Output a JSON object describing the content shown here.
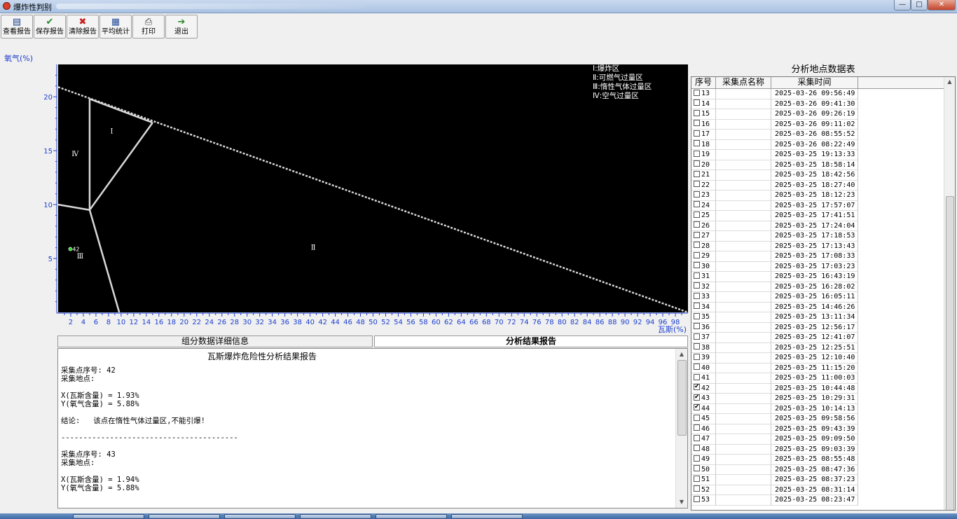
{
  "window": {
    "title": "爆炸性判别",
    "min": "—",
    "max": "□",
    "close": "✕"
  },
  "toolbar": [
    {
      "id": "view",
      "label": "查看报告",
      "icon": "report-icon",
      "glyph": "▤",
      "color": "#1c3f8a"
    },
    {
      "id": "save",
      "label": "保存报告",
      "icon": "check-icon",
      "glyph": "✔",
      "color": "#1e8a2a"
    },
    {
      "id": "clear",
      "label": "清除报告",
      "icon": "x-icon",
      "glyph": "✖",
      "color": "#c81e1e"
    },
    {
      "id": "avg",
      "label": "平均统计",
      "icon": "stats-icon",
      "glyph": "▦",
      "color": "#2a4f9a"
    },
    {
      "id": "print",
      "label": "打印",
      "icon": "printer-icon",
      "glyph": "⎙",
      "color": "#333333"
    },
    {
      "id": "exit",
      "label": "退出",
      "icon": "exit-icon",
      "glyph": "➔",
      "color": "#2e8a24"
    }
  ],
  "chart": {
    "ylabel": "氧气(%)",
    "xlabel": "瓦斯(%)",
    "legend": [
      "Ⅰ:爆炸区",
      "Ⅱ:可燃气过量区",
      "Ⅲ:惰性气体过量区",
      "Ⅳ:空气过量区"
    ],
    "region_labels": [
      {
        "text": "Ⅰ",
        "x": 8.5,
        "y": 16.6
      },
      {
        "text": "Ⅳ",
        "x": 2.7,
        "y": 14.5
      },
      {
        "text": "Ⅱ",
        "x": 40.5,
        "y": 5.8
      },
      {
        "text": "Ⅲ",
        "x": 3.5,
        "y": 5.0
      }
    ],
    "point_label": "42",
    "colors": {
      "background": "#000000",
      "boundary": "#d8d8d8",
      "axis": "#1c3fd0",
      "point": "#22dd22"
    }
  },
  "chart_data": {
    "type": "scatter",
    "title": "",
    "xlabel": "瓦斯(%)",
    "ylabel": "氧气(%)",
    "xlim": [
      0,
      100
    ],
    "ylim": [
      0,
      23
    ],
    "x_ticks": [
      2,
      4,
      6,
      8,
      10,
      12,
      14,
      16,
      18,
      20,
      22,
      24,
      26,
      28,
      30,
      32,
      34,
      36,
      38,
      40,
      42,
      44,
      46,
      48,
      50,
      52,
      54,
      56,
      58,
      60,
      62,
      64,
      66,
      68,
      70,
      72,
      74,
      76,
      78,
      80,
      82,
      84,
      86,
      88,
      90,
      92,
      94,
      96,
      98
    ],
    "y_ticks": [
      5,
      10,
      15,
      20
    ],
    "grid": false,
    "legend_position": "top-right",
    "boundaries": [
      {
        "name": "air-line",
        "x": [
          0,
          100
        ],
        "y": [
          20.9,
          0
        ]
      },
      {
        "name": "upper-limit",
        "x": [
          5,
          15
        ],
        "y": [
          19.8,
          17.6
        ]
      },
      {
        "name": "lower-limit",
        "x": [
          5,
          5
        ],
        "y": [
          19.8,
          9.5
        ]
      },
      {
        "name": "nose",
        "x": [
          5,
          15
        ],
        "y": [
          9.5,
          17.6
        ]
      },
      {
        "name": "lower-explosive-to-left",
        "x": [
          0,
          5
        ],
        "y": [
          10.0,
          9.5
        ]
      },
      {
        "name": "nose-down",
        "x": [
          5,
          9.7
        ],
        "y": [
          9.5,
          0
        ]
      }
    ],
    "series": [
      {
        "x": [
          1.93,
          1.94,
          1.95
        ],
        "y": [
          5.88,
          5.88,
          5.87
        ]
      }
    ]
  },
  "tabs": [
    {
      "label": "组分数据详细信息",
      "active": false
    },
    {
      "label": "分析结果报告",
      "active": true
    }
  ],
  "report": {
    "title": "瓦斯爆炸危险性分析结果报告",
    "lines": [
      "采集点序号: 42",
      "采集地点:",
      "",
      "X(瓦斯含量) = 1.93%",
      "Y(氧气含量) = 5.88%",
      "",
      "结论:   该点在惰性气体过量区,不能引爆!",
      "",
      "----------------------------------------",
      "",
      "采集点序号: 43",
      "采集地点:",
      "",
      "X(瓦斯含量) = 1.94%",
      "Y(氧气含量) = 5.88%"
    ]
  },
  "table": {
    "title": "分析地点数据表",
    "headers": [
      "序号",
      "采集点名称",
      "采集时间"
    ],
    "rows": [
      {
        "no": "13",
        "name": "",
        "time": "2025-03-26 09:56:49",
        "checked": false
      },
      {
        "no": "14",
        "name": "",
        "time": "2025-03-26 09:41:30",
        "checked": false
      },
      {
        "no": "15",
        "name": "",
        "time": "2025-03-26 09:26:19",
        "checked": false
      },
      {
        "no": "16",
        "name": "",
        "time": "2025-03-26 09:11:02",
        "checked": false
      },
      {
        "no": "17",
        "name": "",
        "time": "2025-03-26 08:55:52",
        "checked": false
      },
      {
        "no": "18",
        "name": "",
        "time": "2025-03-26 08:22:49",
        "checked": false
      },
      {
        "no": "19",
        "name": "",
        "time": "2025-03-25 19:13:33",
        "checked": false
      },
      {
        "no": "20",
        "name": "",
        "time": "2025-03-25 18:58:14",
        "checked": false
      },
      {
        "no": "21",
        "name": "",
        "time": "2025-03-25 18:42:56",
        "checked": false
      },
      {
        "no": "22",
        "name": "",
        "time": "2025-03-25 18:27:40",
        "checked": false
      },
      {
        "no": "23",
        "name": "",
        "time": "2025-03-25 18:12:23",
        "checked": false
      },
      {
        "no": "24",
        "name": "",
        "time": "2025-03-25 17:57:07",
        "checked": false
      },
      {
        "no": "25",
        "name": "",
        "time": "2025-03-25 17:41:51",
        "checked": false
      },
      {
        "no": "26",
        "name": "",
        "time": "2025-03-25 17:24:04",
        "checked": false
      },
      {
        "no": "27",
        "name": "",
        "time": "2025-03-25 17:18:53",
        "checked": false
      },
      {
        "no": "28",
        "name": "",
        "time": "2025-03-25 17:13:43",
        "checked": false
      },
      {
        "no": "29",
        "name": "",
        "time": "2025-03-25 17:08:33",
        "checked": false
      },
      {
        "no": "30",
        "name": "",
        "time": "2025-03-25 17:03:23",
        "checked": false
      },
      {
        "no": "31",
        "name": "",
        "time": "2025-03-25 16:43:19",
        "checked": false
      },
      {
        "no": "32",
        "name": "",
        "time": "2025-03-25 16:28:02",
        "checked": false
      },
      {
        "no": "33",
        "name": "",
        "time": "2025-03-25 16:05:11",
        "checked": false
      },
      {
        "no": "34",
        "name": "",
        "time": "2025-03-25 14:46:26",
        "checked": false
      },
      {
        "no": "35",
        "name": "",
        "time": "2025-03-25 13:11:34",
        "checked": false
      },
      {
        "no": "36",
        "name": "",
        "time": "2025-03-25 12:56:17",
        "checked": false
      },
      {
        "no": "37",
        "name": "",
        "time": "2025-03-25 12:41:07",
        "checked": false
      },
      {
        "no": "38",
        "name": "",
        "time": "2025-03-25 12:25:51",
        "checked": false
      },
      {
        "no": "39",
        "name": "",
        "time": "2025-03-25 12:10:40",
        "checked": false
      },
      {
        "no": "40",
        "name": "",
        "time": "2025-03-25 11:15:20",
        "checked": false
      },
      {
        "no": "41",
        "name": "",
        "time": "2025-03-25 11:00:03",
        "checked": false
      },
      {
        "no": "42",
        "name": "",
        "time": "2025-03-25 10:44:48",
        "checked": true
      },
      {
        "no": "43",
        "name": "",
        "time": "2025-03-25 10:29:31",
        "checked": true
      },
      {
        "no": "44",
        "name": "",
        "time": "2025-03-25 10:14:13",
        "checked": true
      },
      {
        "no": "45",
        "name": "",
        "time": "2025-03-25 09:58:56",
        "checked": false
      },
      {
        "no": "46",
        "name": "",
        "time": "2025-03-25 09:43:39",
        "checked": false
      },
      {
        "no": "47",
        "name": "",
        "time": "2025-03-25 09:09:50",
        "checked": false
      },
      {
        "no": "48",
        "name": "",
        "time": "2025-03-25 09:03:39",
        "checked": false
      },
      {
        "no": "49",
        "name": "",
        "time": "2025-03-25 08:55:48",
        "checked": false
      },
      {
        "no": "50",
        "name": "",
        "time": "2025-03-25 08:47:36",
        "checked": false
      },
      {
        "no": "51",
        "name": "",
        "time": "2025-03-25 08:37:23",
        "checked": false
      },
      {
        "no": "52",
        "name": "",
        "time": "2025-03-25 08:31:14",
        "checked": false
      },
      {
        "no": "53",
        "name": "",
        "time": "2025-03-25 08:23:47",
        "checked": false
      }
    ]
  }
}
